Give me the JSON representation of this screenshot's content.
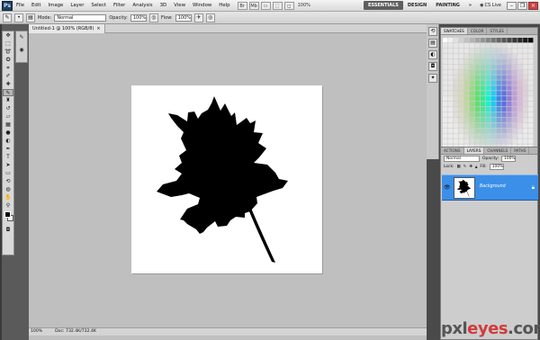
{
  "app": {
    "logo": "Ps"
  },
  "menu": [
    "File",
    "Edit",
    "Image",
    "Layer",
    "Select",
    "Filter",
    "Analysis",
    "3D",
    "View",
    "Window",
    "Help"
  ],
  "menubar_icons": [
    "Br",
    "Mb",
    "▭",
    "⬚",
    "◻"
  ],
  "zoom": "100%",
  "workspaces": {
    "essentials": "ESSENTIALS",
    "design": "DESIGN",
    "painting": "PAINTING",
    "more": "»"
  },
  "cslive": "CS Live",
  "options": {
    "mode_label": "Mode:",
    "mode_value": "Normal",
    "opacity_label": "Opacity:",
    "opacity_value": "100%",
    "flow_label": "Flow:",
    "flow_value": "100%"
  },
  "document": {
    "tab_title": "Untitled-1 @ 100% (RGB/8)",
    "tab_close": "×",
    "status_zoom": "100%",
    "status_doc": "Doc: 732.4K/732.4K"
  },
  "panels": {
    "swatch_tabs": [
      "SWATCHES",
      "COLOR",
      "STYLES"
    ],
    "layer_tabs": [
      "ACTIONS",
      "LAYERS",
      "CHANNELS",
      "PATHS"
    ],
    "blend_mode": "Normal",
    "opacity_label": "Opacity:",
    "opacity_value": "100%",
    "lock_label": "Lock:",
    "fill_label": "Fill:",
    "fill_value": "100%",
    "layer_name": "Background"
  },
  "watermark": {
    "left": "pxl",
    "mid": "eyes",
    "right": ".com"
  },
  "colors": {
    "selected_layer": "#3b8fe8",
    "workspace_bg": "#bfbfbf",
    "leaf": "#000000"
  }
}
